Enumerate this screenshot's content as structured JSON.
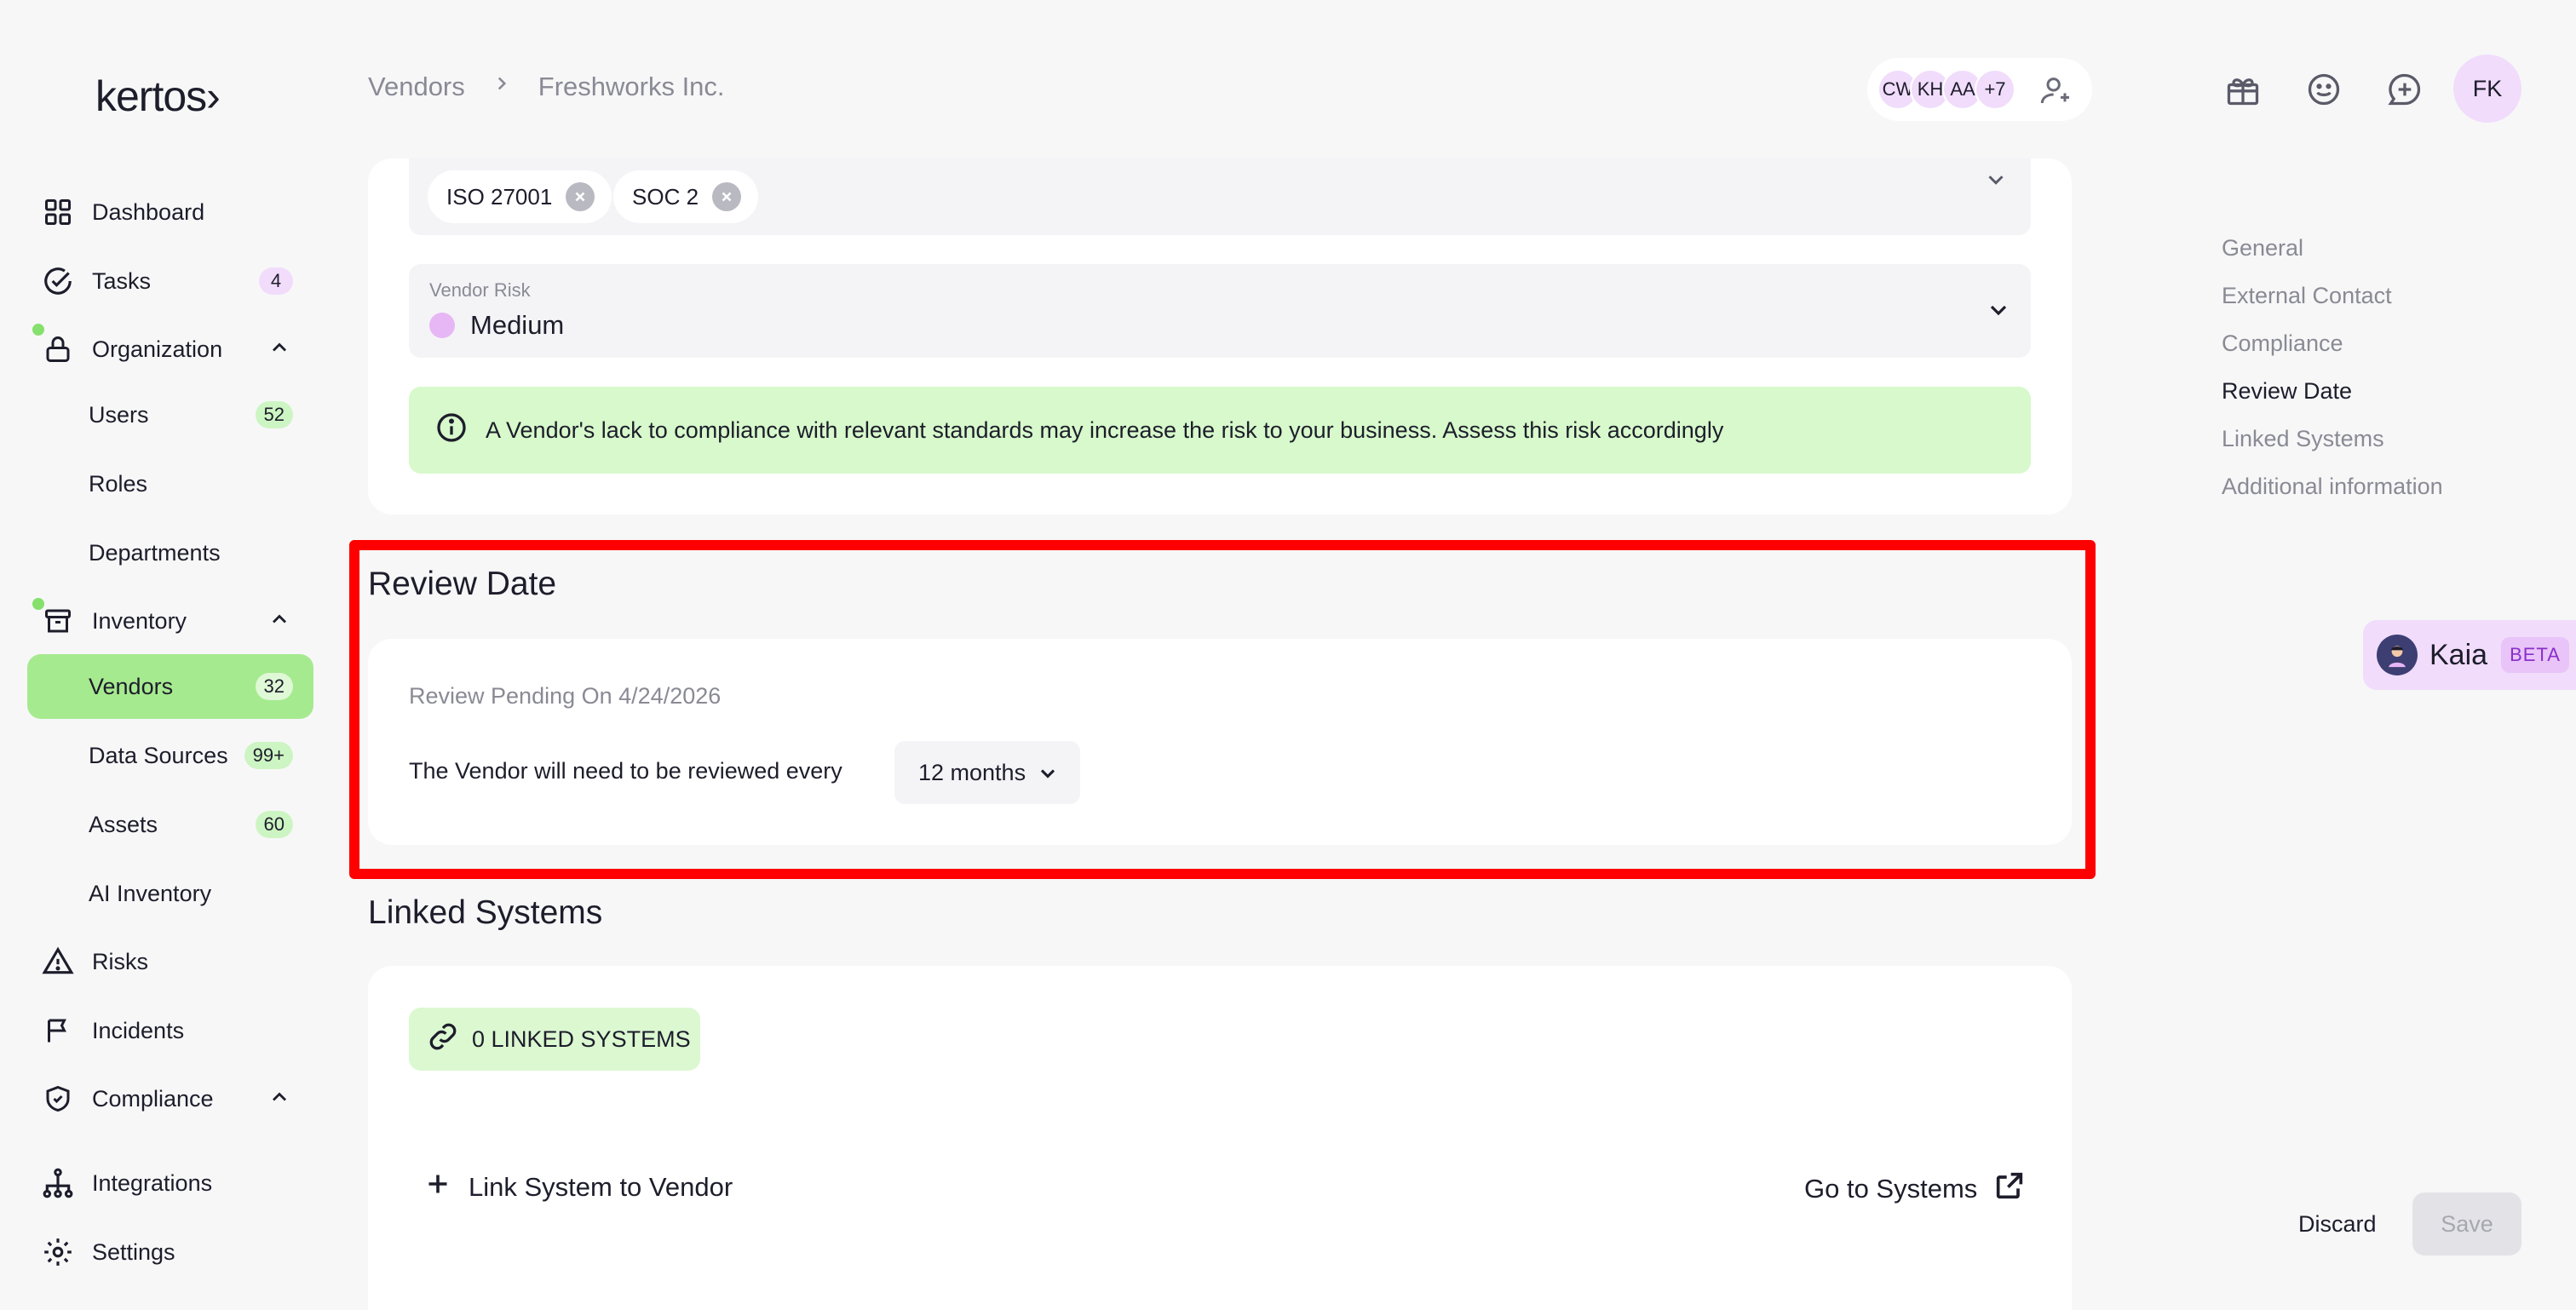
{
  "app": {
    "logo": "kertos›"
  },
  "breadcrumb": {
    "parent": "Vendors",
    "current": "Freshworks Inc."
  },
  "collaborators": {
    "avatars": [
      "CW",
      "KH",
      "AA"
    ],
    "more": "+7"
  },
  "user": {
    "initials": "FK"
  },
  "sidebar": {
    "items": [
      {
        "label": "Dashboard"
      },
      {
        "label": "Tasks",
        "badge": "4"
      },
      {
        "label": "Organization"
      },
      {
        "label": "Users",
        "badge": "52"
      },
      {
        "label": "Roles"
      },
      {
        "label": "Departments"
      },
      {
        "label": "Inventory"
      },
      {
        "label": "Vendors",
        "badge": "32"
      },
      {
        "label": "Data Sources",
        "badge": "99+"
      },
      {
        "label": "Assets",
        "badge": "60"
      },
      {
        "label": "AI Inventory"
      },
      {
        "label": "Risks"
      },
      {
        "label": "Incidents"
      },
      {
        "label": "Compliance"
      },
      {
        "label": "Integrations"
      },
      {
        "label": "Settings"
      }
    ]
  },
  "compliance": {
    "tags": [
      "ISO 27001",
      "SOC 2"
    ],
    "vendor_risk_label": "Vendor Risk",
    "vendor_risk_value": "Medium",
    "alert": "A Vendor's lack to compliance with relevant standards may increase the risk to your business. Assess this risk accordingly"
  },
  "review": {
    "title": "Review Date",
    "pending": "Review Pending On 4/24/2026",
    "interval_text": "The Vendor will need to be reviewed every",
    "interval_value": "12 months"
  },
  "linked": {
    "title": "Linked Systems",
    "count_label": "0 LINKED SYSTEMS",
    "link_button": "Link System to Vendor",
    "go_button": "Go to Systems"
  },
  "toc": [
    "General",
    "External Contact",
    "Compliance",
    "Review Date",
    "Linked Systems",
    "Additional information"
  ],
  "toc_active": "Review Date",
  "kaia": {
    "name": "Kaia",
    "badge": "BETA"
  },
  "actions": {
    "discard": "Discard",
    "save": "Save"
  },
  "colors": {
    "active_nav": "#a6ea8f",
    "highlight": "#ff0000",
    "alert_bg": "#d7f9cb",
    "accent_purple": "#f1dcfb"
  }
}
